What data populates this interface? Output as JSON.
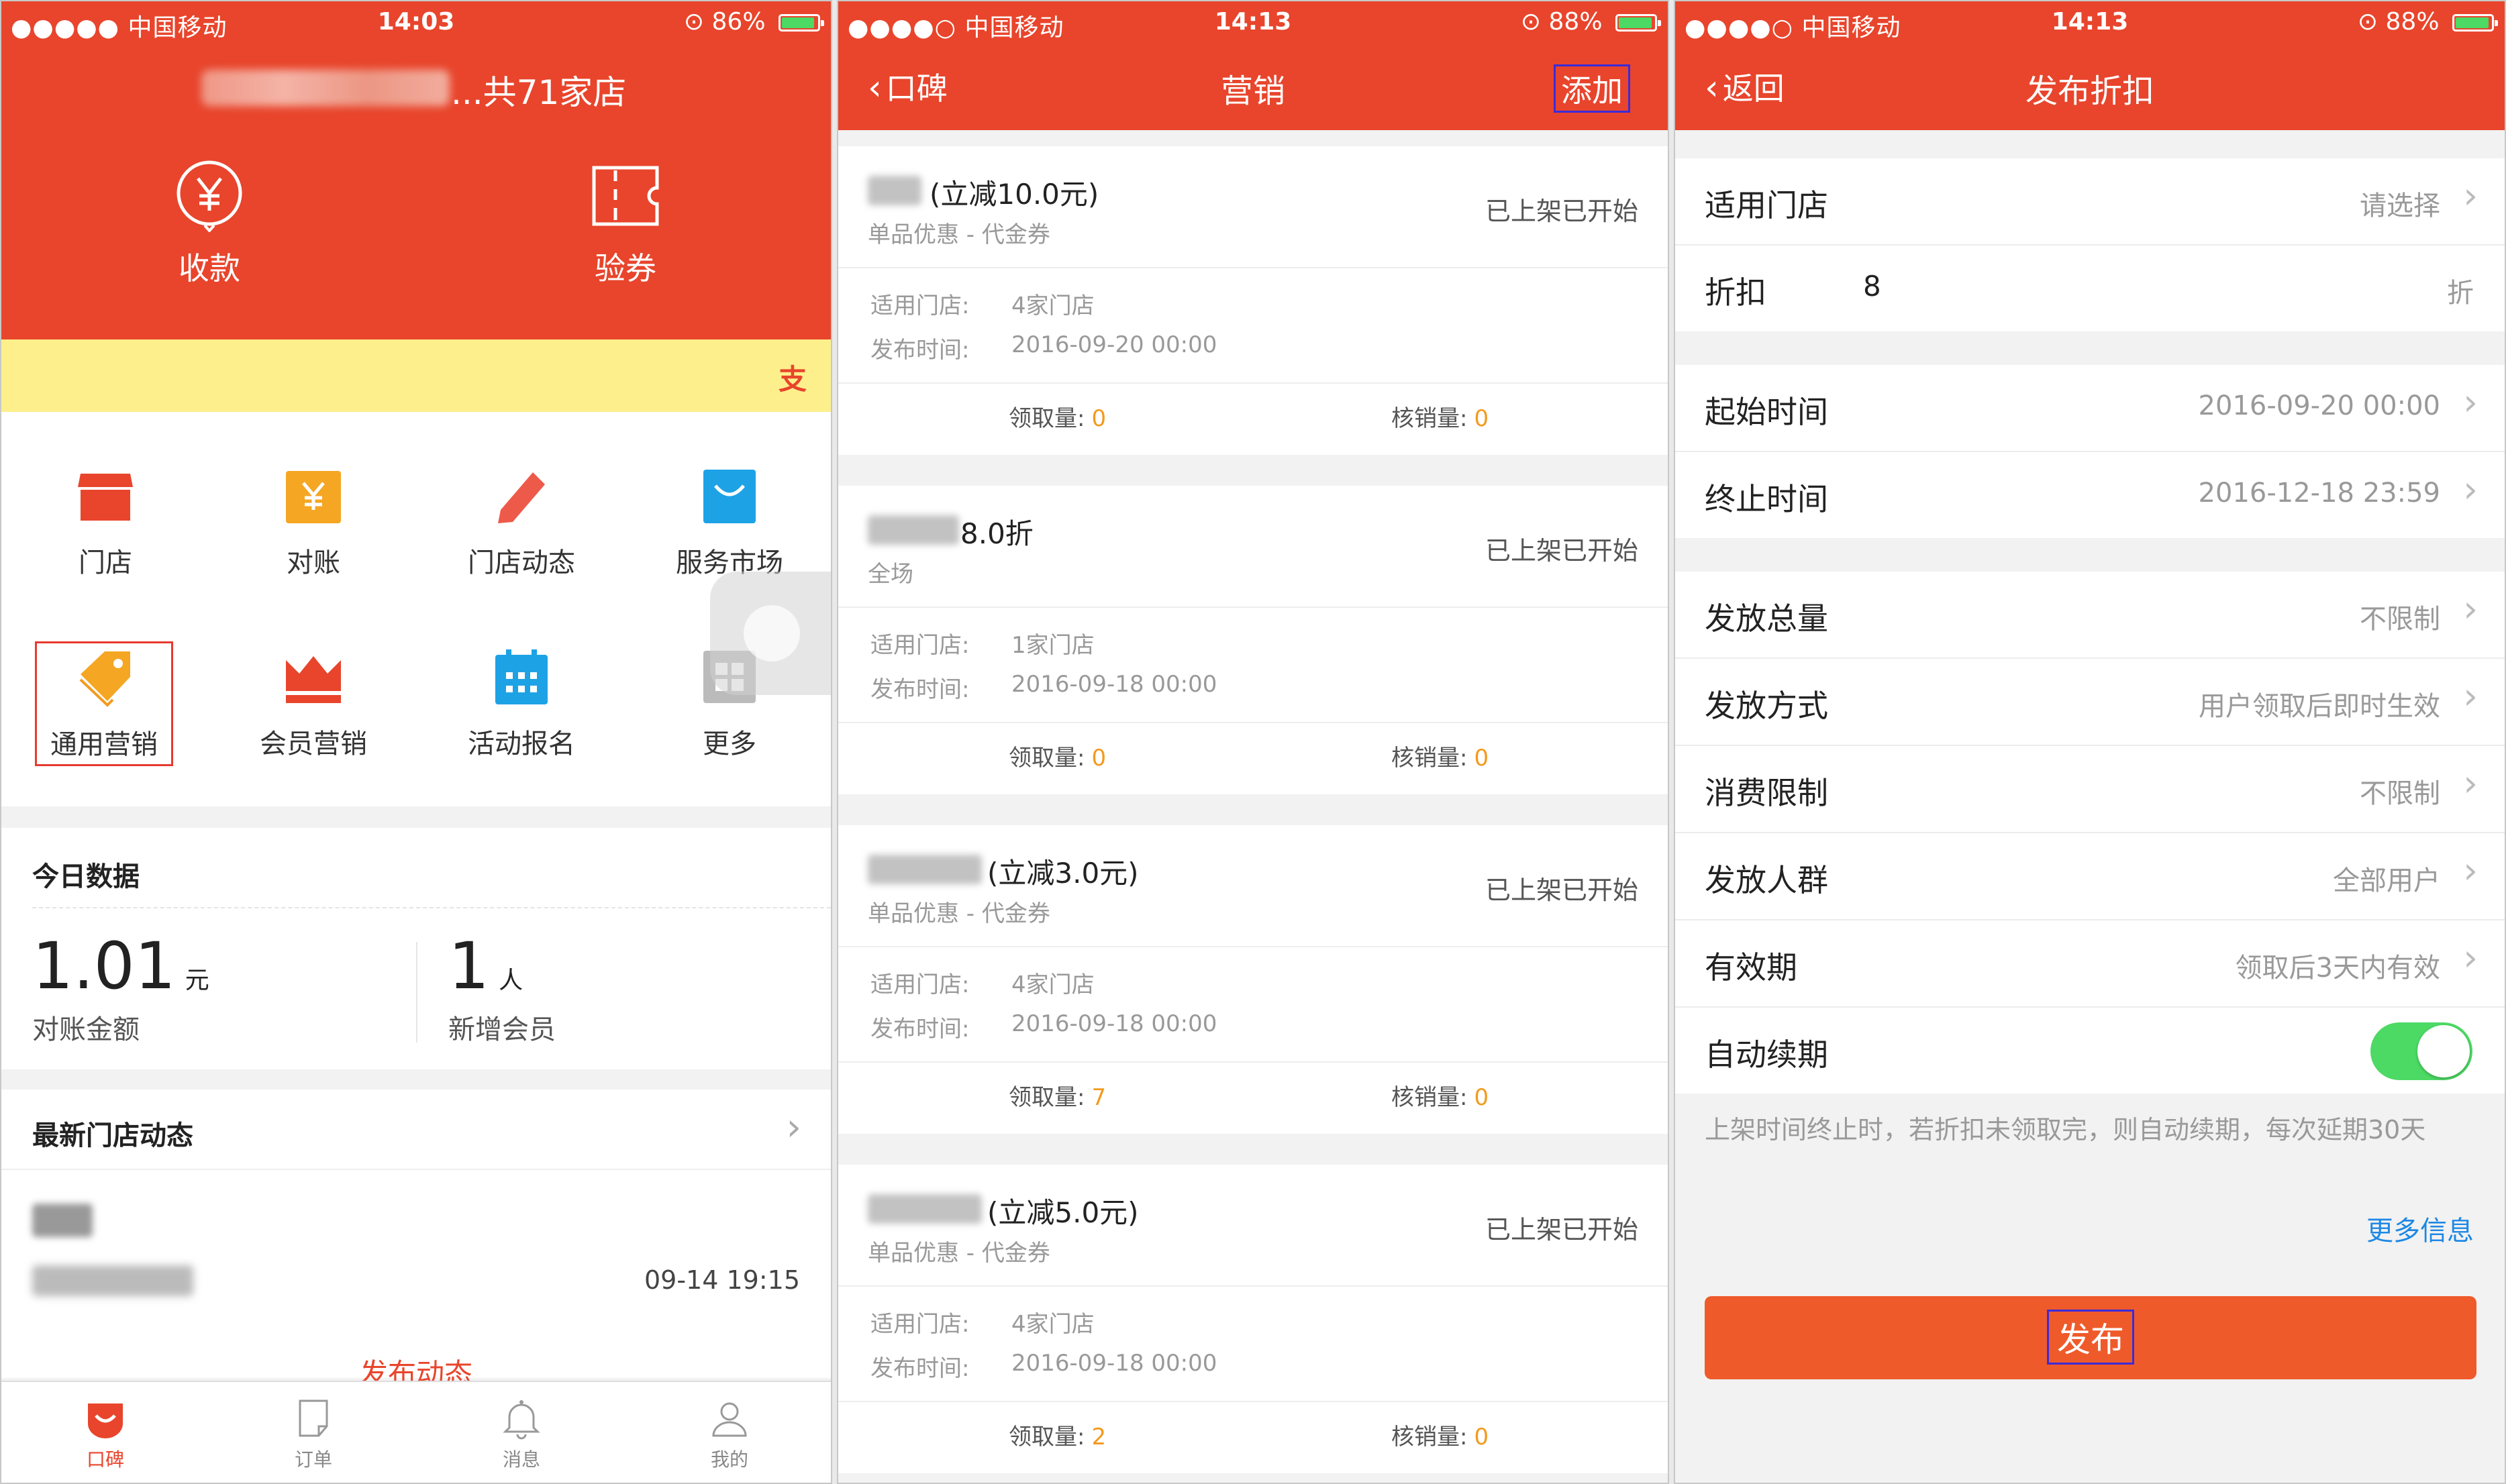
{
  "status_bars": [
    {
      "carrier": "●●●●● 中国移动",
      "time": "14:03",
      "battery": "86%",
      "battery_level": 0.86
    },
    {
      "carrier": "●●●●○ 中国移动",
      "time": "14:13",
      "battery": "88%",
      "battery_level": 0.88
    },
    {
      "carrier": "●●●●○ 中国移动",
      "time": "14:13",
      "battery": "88%",
      "battery_level": 0.88
    }
  ],
  "screen1": {
    "store_title": "...共71家店",
    "quick_actions": [
      {
        "label": "收款",
        "icon": "yuan-circle-icon"
      },
      {
        "label": "验券",
        "icon": "ticket-icon"
      }
    ],
    "notice_tag": "支",
    "grid": [
      {
        "label": "门店",
        "icon": "store-icon",
        "color": "#e8452c"
      },
      {
        "label": "对账",
        "icon": "reconcile-icon",
        "color": "#f5a623"
      },
      {
        "label": "门店动态",
        "icon": "pencil-icon",
        "color": "#ee5a4a"
      },
      {
        "label": "服务市场",
        "icon": "shopping-bag-icon",
        "color": "#1ea2e6"
      },
      {
        "label": "通用营销",
        "icon": "tag-icon",
        "color": "#f5a623"
      },
      {
        "label": "会员营销",
        "icon": "crown-icon",
        "color": "#e8452c"
      },
      {
        "label": "活动报名",
        "icon": "calendar-icon",
        "color": "#1ea2e6"
      },
      {
        "label": "更多",
        "icon": "grid-more-icon",
        "color": "#bbbbbb"
      }
    ],
    "today": {
      "title": "今日数据",
      "amount": "1.01",
      "amount_unit": "元",
      "amount_label": "对账金额",
      "members": "1",
      "members_unit": "人",
      "members_label": "新增会员"
    },
    "news": {
      "title": "最新门店动态",
      "time": "09-14 19:15",
      "publish_label": "发布动态"
    },
    "tabs": [
      {
        "label": "口碑",
        "icon": "koubei-icon",
        "active": true
      },
      {
        "label": "订单",
        "icon": "order-icon",
        "active": false
      },
      {
        "label": "消息",
        "icon": "bell-icon",
        "active": false
      },
      {
        "label": "我的",
        "icon": "user-icon",
        "active": false
      }
    ]
  },
  "screen2": {
    "back_label": "口碑",
    "title": "营销",
    "action_label": "添加",
    "coupons": [
      {
        "name": "(立减10.0元)",
        "type": "单品优惠 - 代金券",
        "state": "已上架已开始",
        "stores_key": "适用门店:",
        "stores": "4家门店",
        "time_key": "发布时间:",
        "time": "2016-09-20 00:00",
        "claimed_label": "领取量:",
        "claimed": "0",
        "verified_label": "核销量:",
        "verified": "0"
      },
      {
        "name": "8.0折",
        "type": "全场",
        "state": "已上架已开始",
        "stores_key": "适用门店:",
        "stores": "1家门店",
        "time_key": "发布时间:",
        "time": "2016-09-18 00:00",
        "claimed_label": "领取量:",
        "claimed": "0",
        "verified_label": "核销量:",
        "verified": "0"
      },
      {
        "name": "(立减3.0元)",
        "type": "单品优惠 - 代金券",
        "state": "已上架已开始",
        "stores_key": "适用门店:",
        "stores": "4家门店",
        "time_key": "发布时间:",
        "time": "2016-09-18 00:00",
        "claimed_label": "领取量:",
        "claimed": "7",
        "verified_label": "核销量:",
        "verified": "0"
      },
      {
        "name": "(立减5.0元)",
        "type": "单品优惠 - 代金券",
        "state": "已上架已开始",
        "stores_key": "适用门店:",
        "stores": "4家门店",
        "time_key": "发布时间:",
        "time": "2016-09-18 00:00",
        "claimed_label": "领取量:",
        "claimed": "2",
        "verified_label": "核销量:",
        "verified": "0"
      }
    ]
  },
  "screen3": {
    "back_label": "返回",
    "title": "发布折扣",
    "stores_label": "适用门店",
    "stores_value": "请选择",
    "discount_label": "折扣",
    "discount_value": "8",
    "discount_unit": "折",
    "start_label": "起始时间",
    "start_value": "2016-09-20 00:00",
    "end_label": "终止时间",
    "end_value": "2016-12-18 23:59",
    "total_label": "发放总量",
    "total_value": "不限制",
    "method_label": "发放方式",
    "method_value": "用户领取后即时生效",
    "limit_label": "消费限制",
    "limit_value": "不限制",
    "audience_label": "发放人群",
    "audience_value": "全部用户",
    "validity_label": "有效期",
    "validity_value": "领取后3天内有效",
    "auto_renew_label": "自动续期",
    "auto_renew_on": true,
    "hint": "上架时间终止时，若折扣未领取完，则自动续期，每次延期30天",
    "more_info": "更多信息",
    "publish_label": "发布"
  },
  "colors": {
    "brand": "#e8452c",
    "notice": "#fdf08c",
    "accent_number": "#f39a1e",
    "toggle_on": "#4cd964",
    "link": "#1e88e5",
    "highlight_box": "#3b2bd8"
  }
}
